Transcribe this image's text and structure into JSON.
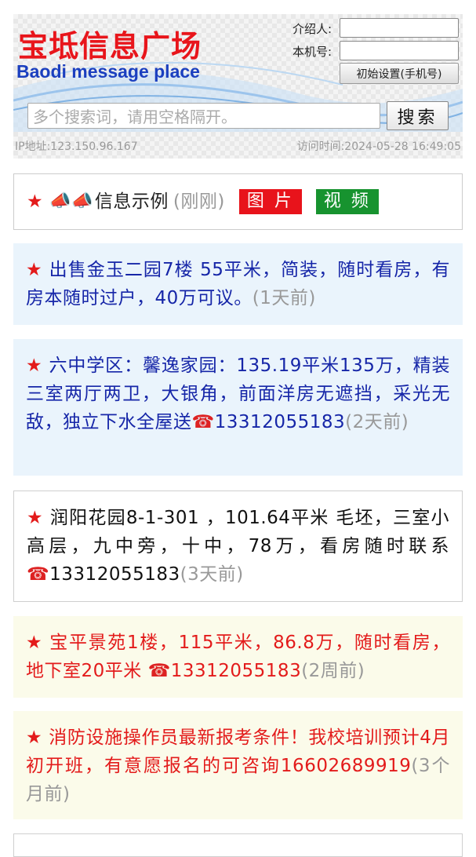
{
  "header": {
    "title_cn": "宝坻信息广场",
    "title_en": "Baodi message place",
    "introducer_label": "介绍人:",
    "phone_label": "本机号:",
    "introducer_value": "",
    "phone_value": "",
    "init_button": "初始设置(手机号)",
    "search_placeholder": "多个搜索词，请用空格隔开。",
    "search_button": "搜索",
    "ip_text": "IP地址:123.150.96.167",
    "visit_time": "访问时间:2024-05-28 16:49:05"
  },
  "example": {
    "star": "★",
    "megaphones": "📣📣",
    "label": "信息示例",
    "ago": "(刚刚)",
    "image_tag": "图 片",
    "video_tag": "视 频"
  },
  "posts": [
    {
      "star": "★",
      "text": "出售金玉二园7楼 55平米，简装，随时看房，有房本随时过户，40万可议。",
      "phone": "",
      "ago": "(1天前)"
    },
    {
      "star": "★",
      "text": "六中学区：馨逸家园：135.19平米135万，精装三室两厅两卫，大银角，前面洋房无遮挡，采光无敌，独立下水全屋送",
      "phone": "13312055183",
      "ago": "(2天前)"
    },
    {
      "star": "★",
      "text": "润阳花园8-1-301 ，101.64平米 毛坯，三室小高层，九中旁，十中，78万，看房随时联系",
      "phone": "13312055183",
      "ago": "(3天前)"
    },
    {
      "star": "★",
      "text": "宝平景苑1楼，115平米，86.8万，随时看房，地下室20平米 ",
      "phone": "13312055183",
      "ago": "(2周前)"
    },
    {
      "star": "★",
      "text": "消防设施操作员最新报考条件！我校培训预计4月初开班，有意愿报名的可咨询16602689919",
      "phone": "",
      "ago": "(3个月前)"
    }
  ],
  "icons": {
    "phone": "☎"
  },
  "colors": {
    "title_red": "#e8151b",
    "title_blue": "#1b3fbf",
    "tag_red": "#e8131b",
    "tag_green": "#17932f",
    "post_blue_text": "#1626a8",
    "post_red_text": "#e31b1b"
  }
}
